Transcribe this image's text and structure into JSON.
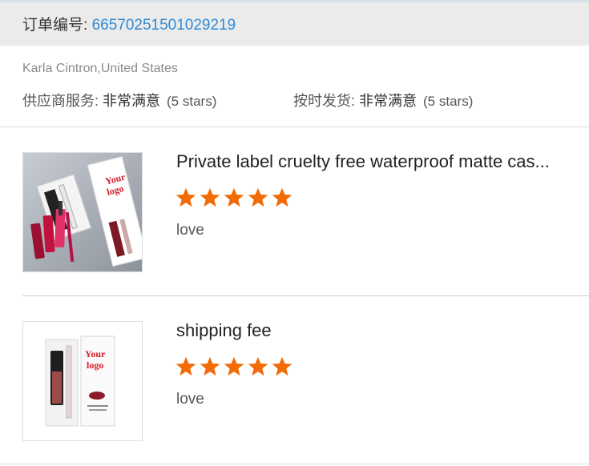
{
  "order": {
    "label": "订单编号: ",
    "id": "66570251501029219"
  },
  "buyer": {
    "name_location": "Karla Cintron,United States"
  },
  "ratings": {
    "supplier_service_label": "供应商服务: ",
    "supplier_service_value": "非常满意",
    "supplier_service_stars": "(5 stars)",
    "on_time_label": "按时发货: ",
    "on_time_value": "非常满意",
    "on_time_stars": "(5 stars)"
  },
  "reviews": [
    {
      "product_title": "Private label cruelty free waterproof matte cas...",
      "rating": 5,
      "comment": "love",
      "thumbnail_icon": "lip-kit-product-photo"
    },
    {
      "product_title": "shipping fee",
      "rating": 5,
      "comment": "love",
      "thumbnail_icon": "lip-kit-box-photo"
    }
  ],
  "colors": {
    "star": "#f26b06",
    "order_id": "#2f8ad6"
  },
  "logo_text": "Your logo"
}
